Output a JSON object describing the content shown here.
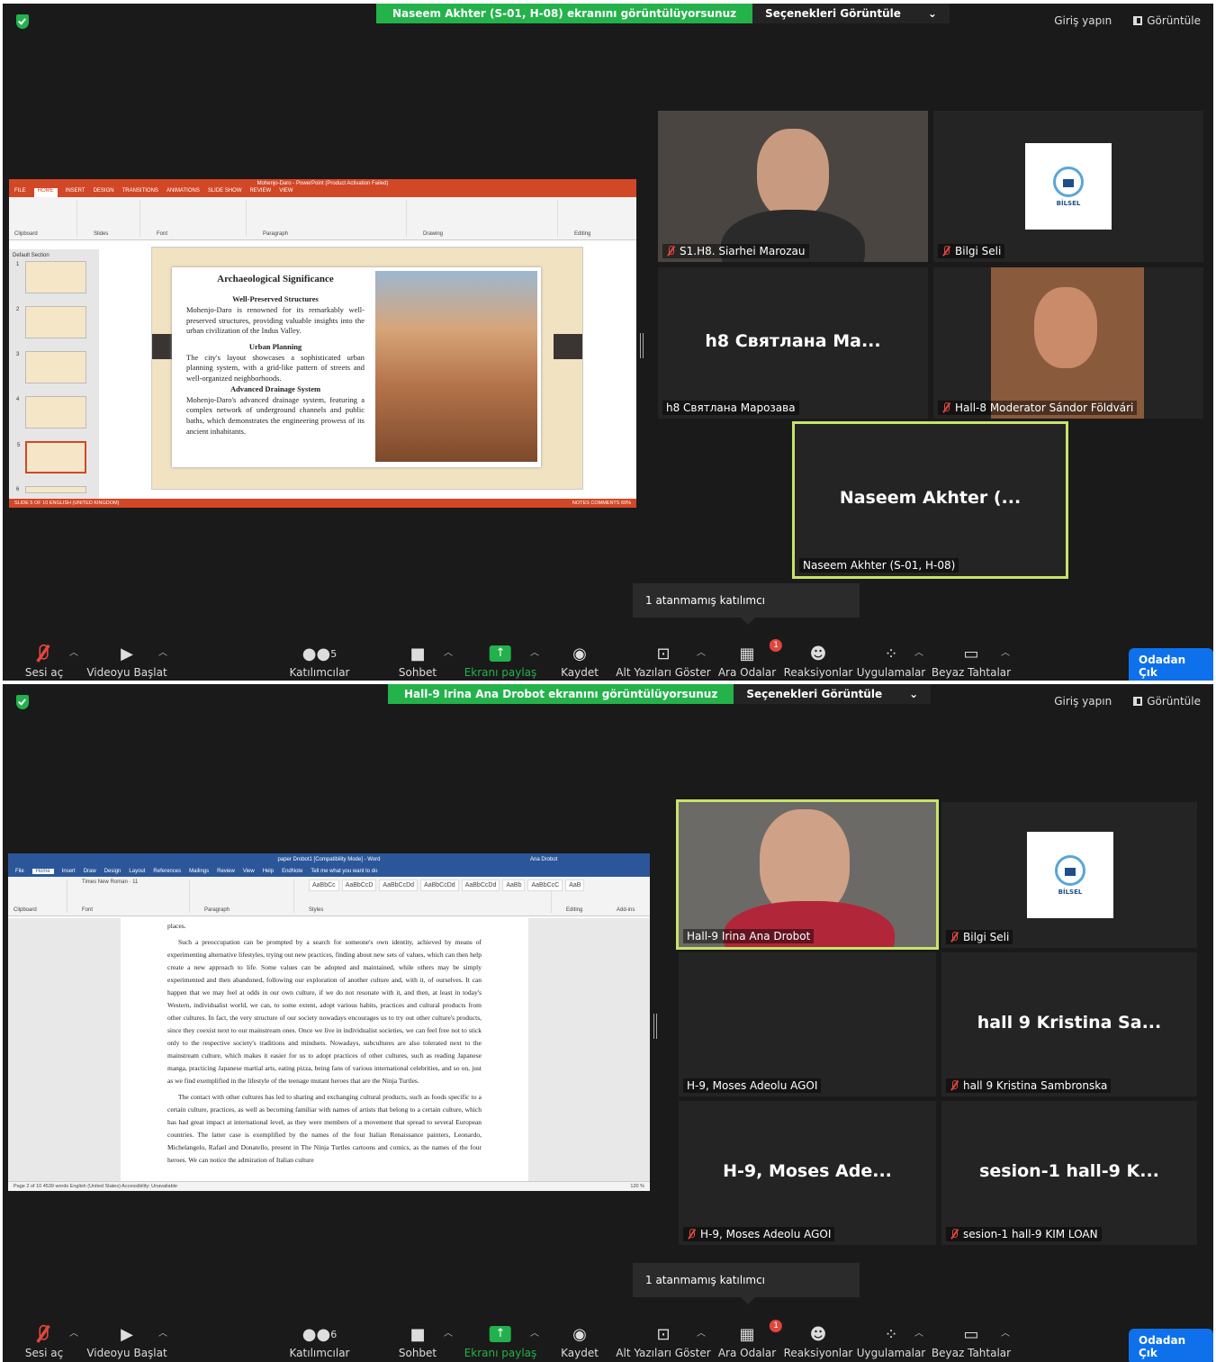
{
  "colors": {
    "accent_green": "#24b24b",
    "leave_blue": "#0e71eb",
    "muted_red": "#e0463d",
    "active_border": "#c7e36a"
  },
  "top_right": {
    "signin": "Giriş yapın",
    "view": "Görüntüle"
  },
  "screens": [
    {
      "banner": "Naseem Akhter (S-01, H-08) ekranını görüntülüyorsunuz",
      "options": "Seçenekleri Görüntüle",
      "options_caret": "⌄",
      "tiles": [
        {
          "name": "S1.H8. Siarhei Marozau"
        },
        {
          "name": "Bilgi Seli"
        },
        {
          "name": "h8 Святлана Марозава",
          "big": "h8 Святлана Ма..."
        },
        {
          "name": "Hall-8 Moderator Sándor Földvári"
        },
        {
          "name": "Naseem Akhter (S-01, H-08)",
          "big": "Naseem Akhter (..."
        }
      ],
      "logo_text": "BİLSEL",
      "popup": "1 atanmamış katılımcı",
      "participants_count": "5",
      "ppt": {
        "title": "Mohenjo-Daro - PowerPoint (Product Activation Failed)",
        "tabs": [
          "FILE",
          "HOME",
          "INSERT",
          "DESIGN",
          "TRANSITIONS",
          "ANIMATIONS",
          "SLIDE SHOW",
          "REVIEW",
          "VIEW"
        ],
        "groups": [
          "Clipboard",
          "Slides",
          "Font",
          "Paragraph",
          "Drawing",
          "Editing"
        ],
        "section": "Default Section",
        "slide_numbers": [
          "1",
          "2",
          "3",
          "4",
          "5",
          "6"
        ],
        "slide_title": "Archaeological Significance",
        "h1": "Well-Preserved Structures",
        "p1": "Mohenjo-Daro is renowned for its remarkably well-preserved structures, providing valuable insights into the urban civilization of the Indus Valley.",
        "h2": "Urban Planning",
        "p2": "The city's layout showcases a sophisticated urban planning system, with a grid-like pattern of streets and well-organized neighborhoods.",
        "h3": "Advanced Drainage System",
        "p3": "Mohenjo-Daro's advanced drainage system, featuring a complex network of underground channels and public baths, which demonstrates the engineering prowess of its ancient inhabitants.",
        "status": "SLIDE 5 OF 10    ENGLISH (UNITED KINGDOM)",
        "status_right": "NOTES   COMMENTS   69%"
      }
    },
    {
      "banner": "Hall-9 Irina Ana Drobot ekranını görüntülüyorsunuz",
      "options": "Seçenekleri Görüntüle",
      "options_caret": "⌄",
      "tiles": [
        {
          "name": "Hall-9 Irina Ana Drobot"
        },
        {
          "name": "Bilgi Seli"
        },
        {
          "name": "H-9, Moses Adeolu AGOI"
        },
        {
          "name": "hall 9 Kristina Sambronska",
          "big": "hall 9 Kristina Sa..."
        },
        {
          "name": "H-9, Moses Adeolu AGOI",
          "big": "H-9, Moses Ade..."
        },
        {
          "name": "sesion-1 hall-9 KIM LOAN",
          "big": "sesion-1 hall-9 K..."
        }
      ],
      "logo_text": "BİLSEL",
      "popup": "1 atanmamış katılımcı",
      "participants_count": "6",
      "word": {
        "title": "paper Drobot1 [Compatibility Mode]  -  Word",
        "user": "Ana Drobot",
        "tabs": [
          "File",
          "Home",
          "Insert",
          "Draw",
          "Design",
          "Layout",
          "References",
          "Mailings",
          "Review",
          "View",
          "Help",
          "EndNote",
          "Tell me what you want to do"
        ],
        "font": "Times New Roman",
        "size": "11",
        "styles": [
          "AaBbCc",
          "AaBbCcD",
          "AaBbCcDd",
          "AaBbCcDd",
          "AaBbCcDd",
          "AaBb",
          "AaBbCcC",
          "AaB"
        ],
        "groups": [
          "Clipboard",
          "Font",
          "Paragraph",
          "Styles",
          "Editing",
          "Add-ins"
        ],
        "line0": "places.",
        "para1": "Such a preoccupation can be prompted by a search for someone's own identity, achieved by means of experimenting alternative lifestyles, trying out new practices, finding about new sets of values, which can then help create a new approach to life. Some values can be adopted and maintained, while others may be simply experimented and then abandoned, following our exploration of another culture and, with it, of ourselves. It can happen that we may feel at odds in our own culture, if we do not resonate with it, and then, at least in today's Western, individualist world, we can, to some extent, adopt various habits, practices and cultural products from other cultures. In fact, the very structure of our society nowadays encourages us to try out other culture's products, since they coexist next to our mainstream ones. Once we live in individualist societies, we can feel free not to stick only to the respective society's traditions and mindsets. Nowadays, subcultures are also tolerated next to the mainstream culture, which makes it easier for us to adopt practices of other cultures, such as reading Japanese manga, practicing Japanese martial arts, eating pizza, being fans of various international celebrities, and so on, just as we find exemplified in the lifestyle of the teenage mutant heroes that are the Ninja Turtles.",
        "para2": "The contact with other cultures has led to sharing and exchanging cultural products, such as foods specific to a certain culture, practices, as well as becoming familiar with names of artists that belong to a certain culture, which has had great impact at international level, as they were members of a movement that spread to several European countries. The latter case is exemplified by the names of the four Italian Renaissance painters, Leonardo, Michelangelo, Rafael and Donatello, present in The Ninja Turtles cartoons and comics, as the names of the four heroes. We can notice the admiration of Italian culture",
        "status": "Page 2 of 10   4539 words   English (United States)   Accessibility: Unavailable",
        "zoom": "120 %"
      }
    }
  ],
  "toolbar": [
    {
      "label": "Sesi aç",
      "icon": "mic-muted-icon"
    },
    {
      "label": "Videoyu Başlat",
      "icon": "video-off-icon"
    },
    {
      "label": "Katılımcılar",
      "icon": "participants-icon"
    },
    {
      "label": "Sohbet",
      "icon": "chat-icon"
    },
    {
      "label": "Ekranı paylaş",
      "icon": "share-screen-icon"
    },
    {
      "label": "Kaydet",
      "icon": "record-icon"
    },
    {
      "label": "Alt Yazıları Göster",
      "icon": "cc-icon"
    },
    {
      "label": "Ara Odalar",
      "icon": "breakout-rooms-icon",
      "badge": "1"
    },
    {
      "label": "Reaksiyonlar",
      "icon": "reactions-icon"
    },
    {
      "label": "Uygulamalar",
      "icon": "apps-icon"
    },
    {
      "label": "Beyaz Tahtalar",
      "icon": "whiteboard-icon"
    }
  ],
  "leave": "Odadan Çık"
}
